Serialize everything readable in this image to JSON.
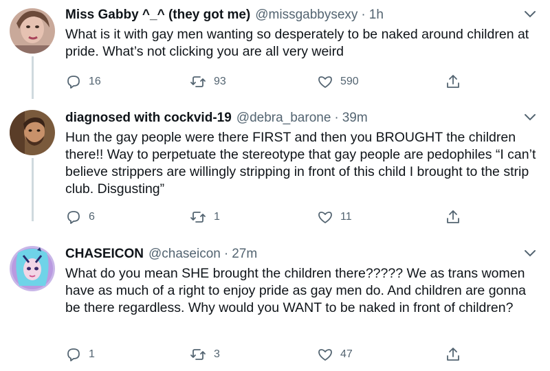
{
  "tweets": [
    {
      "display_name": "Miss Gabby ^_^ (they got me)",
      "handle": "@missgabbysexy",
      "separator": "·",
      "time": "1h",
      "text": "What is it with gay men wanting so desperately to be naked around children at pride. What’s not clicking you are all very weird",
      "replies": "16",
      "retweets": "93",
      "likes": "590"
    },
    {
      "display_name": "diagnosed with cockvid-19",
      "handle": "@debra_barone",
      "separator": "·",
      "time": "39m",
      "text": "Hun the gay people were there FIRST and then you BROUGHT the children there!! Way to perpetuate the stereotype that gay people are pedophiles “I can’t believe strippers are willingly stripping in front of this child I brought to the strip club. Disgusting”",
      "replies": "6",
      "retweets": "1",
      "likes": "11"
    },
    {
      "display_name": "CHASEICON",
      "handle": "@chaseicon",
      "separator": "·",
      "time": "27m",
      "text": "What do you mean SHE brought the children there????? We as trans women have as much of a right to enjoy pride as gay men do. And children are gonna be there regardless. Why would you WANT to be naked in front of children?",
      "replies": "1",
      "retweets": "3",
      "likes": "47"
    }
  ],
  "colors": {
    "text_primary": "#0f1419",
    "text_secondary": "#536471",
    "thread_line": "#cfd9de",
    "icon": "#536471"
  },
  "icons": {
    "reply": "reply-icon",
    "retweet": "retweet-icon",
    "like": "heart-icon",
    "share": "share-icon",
    "more": "chevron-down-icon"
  }
}
